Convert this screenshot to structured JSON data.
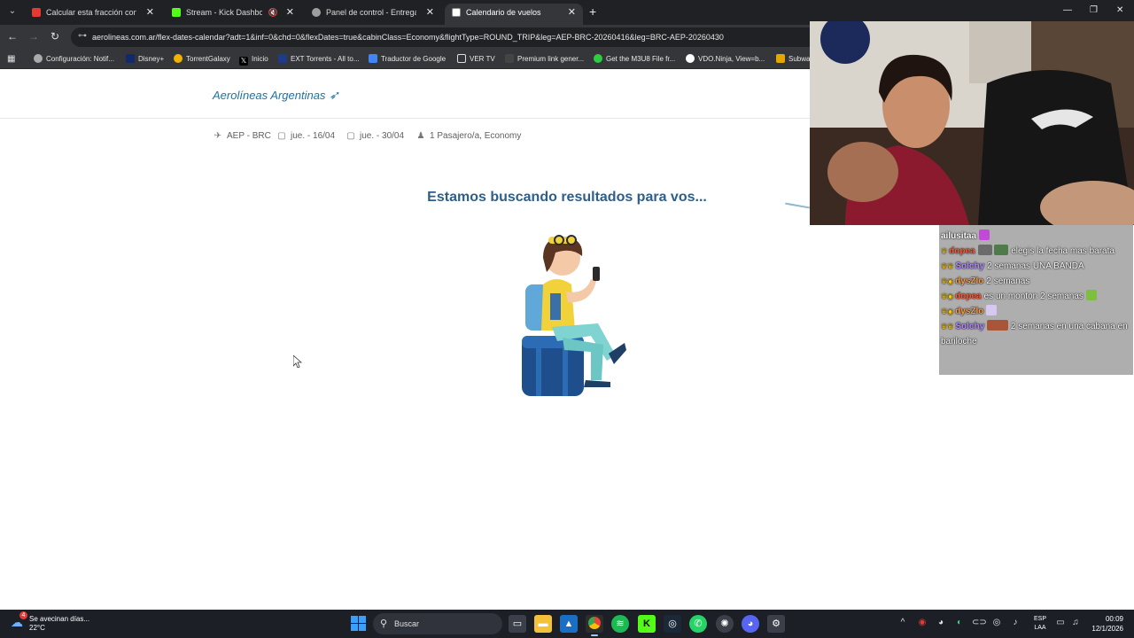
{
  "browser": {
    "tabs": [
      {
        "title": "Calcular esta fracción con pote",
        "favicon_color": "#e53935",
        "active": false
      },
      {
        "title": "Stream - Kick Dashboard",
        "favicon_color": "#53fc18",
        "active": false,
        "muted": true
      },
      {
        "title": "Panel de control - Entregas de",
        "favicon_color": "#9e9e9e",
        "active": false
      },
      {
        "title": "Calendario de vuelos",
        "favicon_color": "#ffffff",
        "active": true
      }
    ],
    "url": "aerolineas.com.ar/flex-dates-calendar?adt=1&inf=0&chd=0&flexDates=true&cabinClass=Economy&flightType=ROUND_TRIP&leg=AEP-BRC-20260416&leg=BRC-AEP-20260430",
    "bookmarks": [
      {
        "label": "Configuración: Notif...",
        "icon": "gear-icon"
      },
      {
        "label": "Disney+",
        "icon": "disney-icon"
      },
      {
        "label": "TorrentGalaxy",
        "icon": "torrentgalaxy-icon"
      },
      {
        "label": "Inicio",
        "icon": "x-icon"
      },
      {
        "label": "EXT Torrents - All to...",
        "icon": "ext-icon"
      },
      {
        "label": "Traductor de Google",
        "icon": "translate-icon"
      },
      {
        "label": "VER TV",
        "icon": "folder-icon"
      },
      {
        "label": "Premium link gener...",
        "icon": "link-icon"
      },
      {
        "label": "Get the M3U8 File fr...",
        "icon": "m3u8-icon"
      },
      {
        "label": "VDO.Ninja, View=b...",
        "icon": "vdo-icon"
      },
      {
        "label": "Subwa",
        "icon": "subway-icon"
      }
    ]
  },
  "site": {
    "logo_text": "Aerolíneas Argentinas",
    "summary": {
      "route": "AEP - BRC",
      "depart": "jue. - 16/04",
      "return": "jue. - 30/04",
      "passengers": "1 Pasajero/a, Economy"
    },
    "loading_title": "Estamos buscando resultados para vos..."
  },
  "chat": {
    "messages": [
      {
        "user": "ailusitaa",
        "color": "#ffffff",
        "text": "",
        "badges": ""
      },
      {
        "user": "dopea",
        "color": "#ff5a36",
        "text": "elegis la fecha mas barata",
        "badges": "♛"
      },
      {
        "user": "Solchy",
        "color": "#b28cff",
        "text": "2 semanas UNA BANDA",
        "badges": "♛♛"
      },
      {
        "user": "dysZlo",
        "color": "#ff9a3c",
        "text": "2 semanas",
        "badges": "♛◉"
      },
      {
        "user": "dopea",
        "color": "#ff5a36",
        "text": "es un monton 2 semanas",
        "badges": "♛◉"
      },
      {
        "user": "dysZlo",
        "color": "#ff9a3c",
        "text": "",
        "badges": "♛◉"
      },
      {
        "user": "Solchy",
        "color": "#b28cff",
        "text": "2 semanas en una cabana en bariloche",
        "badges": "♛♛"
      }
    ]
  },
  "taskbar": {
    "weather_text": "Se avecinan días...",
    "weather_temp": "22°C",
    "weather_badge": "4",
    "search_placeholder": "Buscar",
    "lang_line1": "ESP",
    "lang_line2": "LAA",
    "time": "00:09",
    "date": "12/1/2026"
  },
  "colors": {
    "brand": "#1a73a8",
    "title": "#2d5f8a"
  }
}
